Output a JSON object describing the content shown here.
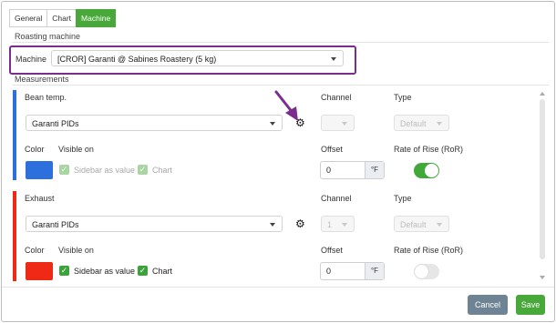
{
  "tabs": [
    {
      "label": "General"
    },
    {
      "label": "Chart"
    },
    {
      "label": "Machine"
    }
  ],
  "roasting_machine": {
    "title": "Roasting machine",
    "machine_label": "Machine",
    "machine_value": "[CROR] Garanti @ Sabines Roastery (5 kg)"
  },
  "measurements": {
    "title": "Measurements",
    "headers": {
      "channel": "Channel",
      "type": "Type",
      "color": "Color",
      "visible_on": "Visible on",
      "offset": "Offset",
      "ror": "Rate of Rise (RoR)"
    },
    "items": [
      {
        "name": "Bean temp.",
        "source": "Garanti PIDs",
        "channel": "",
        "type": "Default",
        "color": "#2d6fdc",
        "sidebar_label": "Sidebar as value",
        "chart_label": "Chart",
        "sidebar_checked": true,
        "chart_checked": true,
        "checks_disabled": true,
        "offset": "0",
        "unit": "°F",
        "ror_enabled": true
      },
      {
        "name": "Exhaust",
        "source": "Garanti PIDs",
        "channel": "1",
        "type": "Default",
        "color": "#ee2a17",
        "sidebar_label": "Sidebar as value",
        "chart_label": "Chart",
        "sidebar_checked": true,
        "chart_checked": true,
        "checks_disabled": false,
        "offset": "0",
        "unit": "°F",
        "ror_enabled": false
      }
    ]
  },
  "buttons": {
    "cancel": "Cancel",
    "save": "Save"
  },
  "colors": {
    "accent": "#49a83a",
    "highlight": "#7b2d8e",
    "cancel": "#6e8494"
  },
  "icons": {
    "gear": "gear-icon",
    "check": "check-icon",
    "caret": "chevron-down-icon",
    "annotation": "arrow-annotation"
  }
}
